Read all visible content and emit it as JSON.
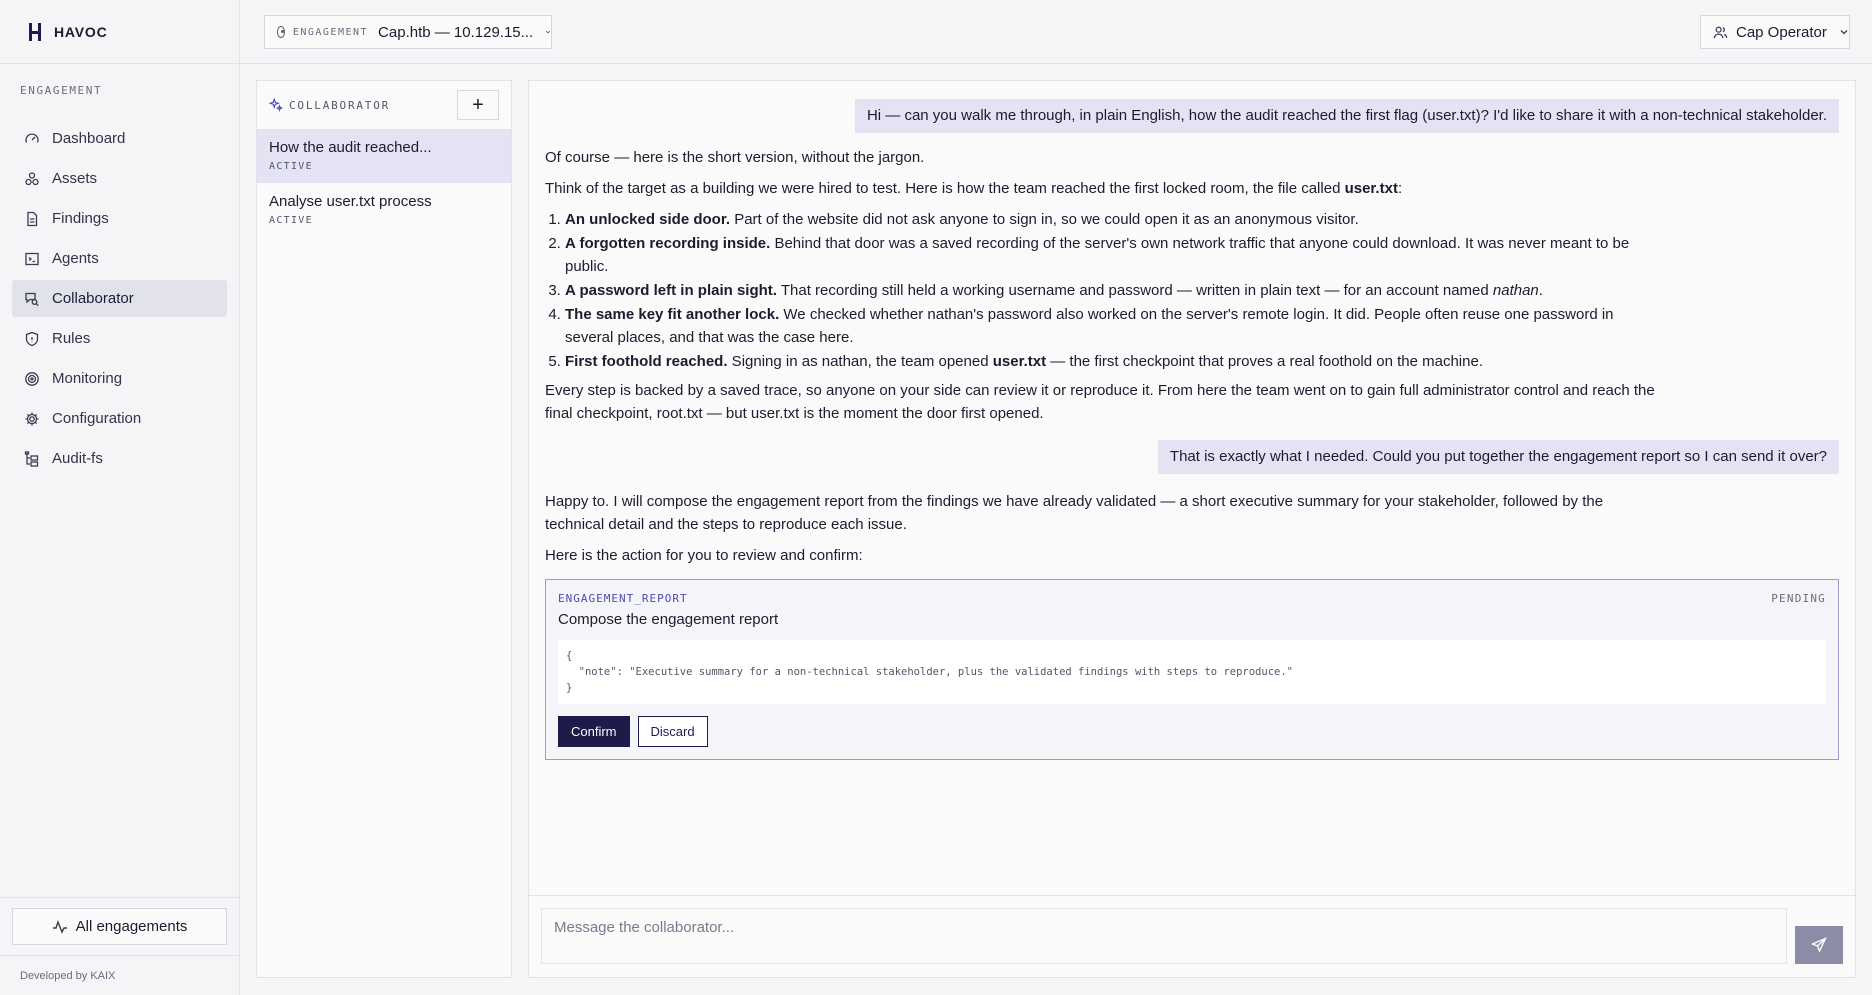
{
  "brand": {
    "name": "HAVOC"
  },
  "sidebar": {
    "section_label": "ENGAGEMENT",
    "items": [
      {
        "label": "Dashboard",
        "icon": "gauge-icon"
      },
      {
        "label": "Assets",
        "icon": "boxes-icon"
      },
      {
        "label": "Findings",
        "icon": "file-icon"
      },
      {
        "label": "Agents",
        "icon": "terminal-icon"
      },
      {
        "label": "Collaborator",
        "icon": "chat-search-icon",
        "active": true
      },
      {
        "label": "Rules",
        "icon": "shield-icon"
      },
      {
        "label": "Monitoring",
        "icon": "radar-icon"
      },
      {
        "label": "Configuration",
        "icon": "gear-icon"
      },
      {
        "label": "Audit-fs",
        "icon": "folder-tree-icon"
      }
    ],
    "all_engagements": "All engagements",
    "developed_by": "Developed by KAIX"
  },
  "topbar": {
    "engagement_label": "ENGAGEMENT",
    "engagement_value": "Cap.htb — 10.129.15...",
    "user": "Cap Operator"
  },
  "conversations": {
    "title": "COLLABORATOR",
    "new_label": "+",
    "items": [
      {
        "title": "How the audit reached...",
        "status": "ACTIVE"
      },
      {
        "title": "Analyse user.txt process",
        "status": "ACTIVE"
      }
    ]
  },
  "chat": {
    "user_msg_1": "Hi — can you walk me through, in plain English, how the audit reached the first flag (user.txt)? I'd like to share it with a non-technical stakeholder.",
    "reply_1": {
      "intro": "Of course — here is the short version, without the jargon.",
      "lead_before": "Think of the target as a building we were hired to test. Here is how the team reached the first locked room, the file called ",
      "lead_bold": "user.txt",
      "lead_after": ":",
      "steps": [
        {
          "bold": "An unlocked side door.",
          "text": " Part of the website did not ask anyone to sign in, so we could open it as an anonymous visitor."
        },
        {
          "bold": "A forgotten recording inside.",
          "text": " Behind that door was a saved recording of the server's own network traffic that anyone could download. It was never meant to be public."
        },
        {
          "bold": "A password left in plain sight.",
          "text": " That recording still held a working username and password — written in plain text — for an account named ",
          "em": "nathan",
          "tail": "."
        },
        {
          "bold": "The same key fit another lock.",
          "text": " We checked whether nathan's password also worked on the server's remote login. It did. People often reuse one password in several places, and that was the case here."
        },
        {
          "bold": "First foothold reached.",
          "text": " Signing in as nathan, the team opened ",
          "file": "user.txt",
          "tail": " — the first checkpoint that proves a real foothold on the machine."
        }
      ],
      "outro": "Every step is backed by a saved trace, so anyone on your side can review it or reproduce it. From here the team went on to gain full administrator control and reach the final checkpoint, root.txt — but user.txt is the moment the door first opened."
    },
    "user_msg_2": "That is exactly what I needed. Could you put together the engagement report so I can send it over?",
    "reply_2": {
      "p1": "Happy to. I will compose the engagement report from the findings we have already validated — a short executive summary for your stakeholder, followed by the technical detail and the steps to reproduce each issue.",
      "p2": "Here is the action for you to review and confirm:"
    },
    "action": {
      "type": "ENGAGEMENT_REPORT",
      "status": "PENDING",
      "title": "Compose the engagement report",
      "payload": "{\n  \"note\": \"Executive summary for a non-technical stakeholder, plus the validated findings with steps to reproduce.\"\n}",
      "confirm_label": "Confirm",
      "discard_label": "Discard"
    },
    "composer_placeholder": "Message the collaborator..."
  }
}
